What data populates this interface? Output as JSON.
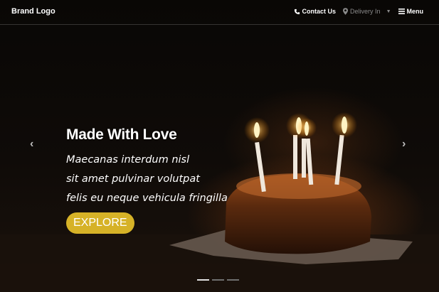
{
  "header": {
    "brand": "Brand Logo",
    "nav": {
      "contact": "Contact Us",
      "delivery": "Delivery In",
      "menu": "Menu"
    }
  },
  "hero": {
    "title": "Made With Love",
    "lines": [
      "Maecanas interdum nisl",
      "sit amet pulvinar volutpat",
      "felis eu neque vehicula fringilla"
    ],
    "cta": "EXPLORE",
    "slide_count": 3,
    "active_slide": 1
  },
  "icons": {
    "contact": "phone-icon",
    "delivery": "map-pin-icon",
    "menu": "hamburger-icon",
    "prev": "chevron-left-icon",
    "next": "chevron-right-icon"
  },
  "colors": {
    "accent": "#d6b227",
    "text": "#ffffff",
    "muted": "#8a8a8a"
  }
}
